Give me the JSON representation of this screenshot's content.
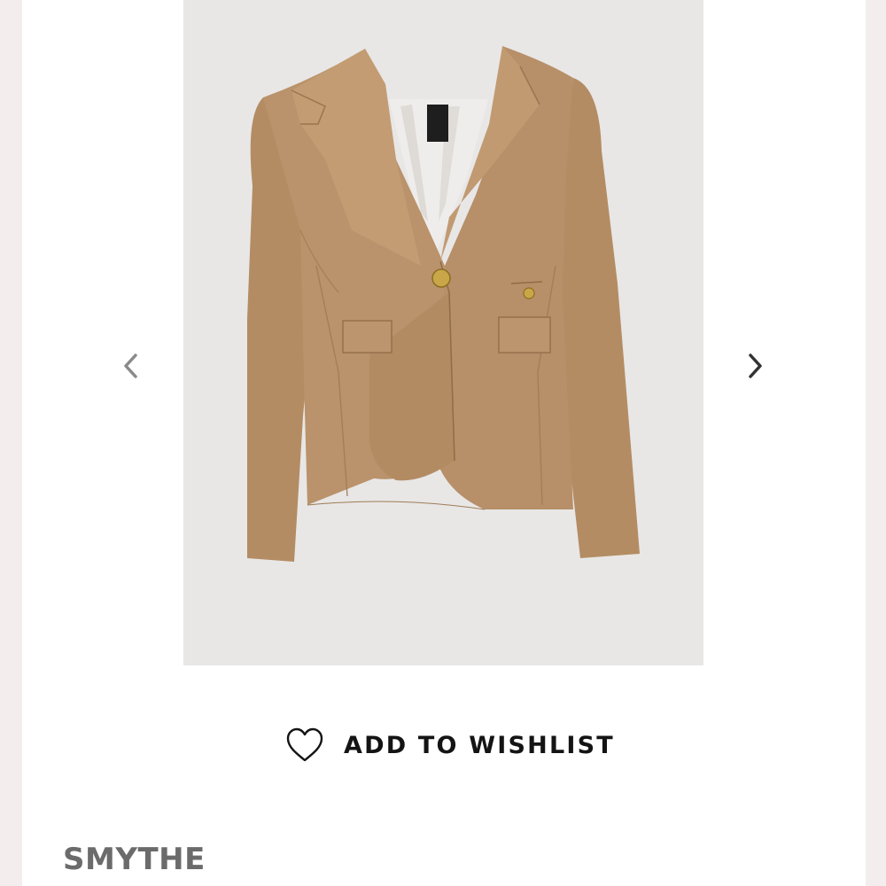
{
  "product": {
    "image_alt": "Camel single-button blazer",
    "tag_text": "SMYTHE",
    "brand": "SMYTHE"
  },
  "gallery": {
    "prev_icon": "chevron-left-icon",
    "next_icon": "chevron-right-icon"
  },
  "wishlist": {
    "label": "ADD TO WISHLIST",
    "icon": "heart-icon"
  },
  "colors": {
    "background": "#ffffff",
    "gallery_bg": "#e8e7e6",
    "blazer": "#b8916a",
    "text": "#141414",
    "brand_text": "#6b6b6b"
  }
}
